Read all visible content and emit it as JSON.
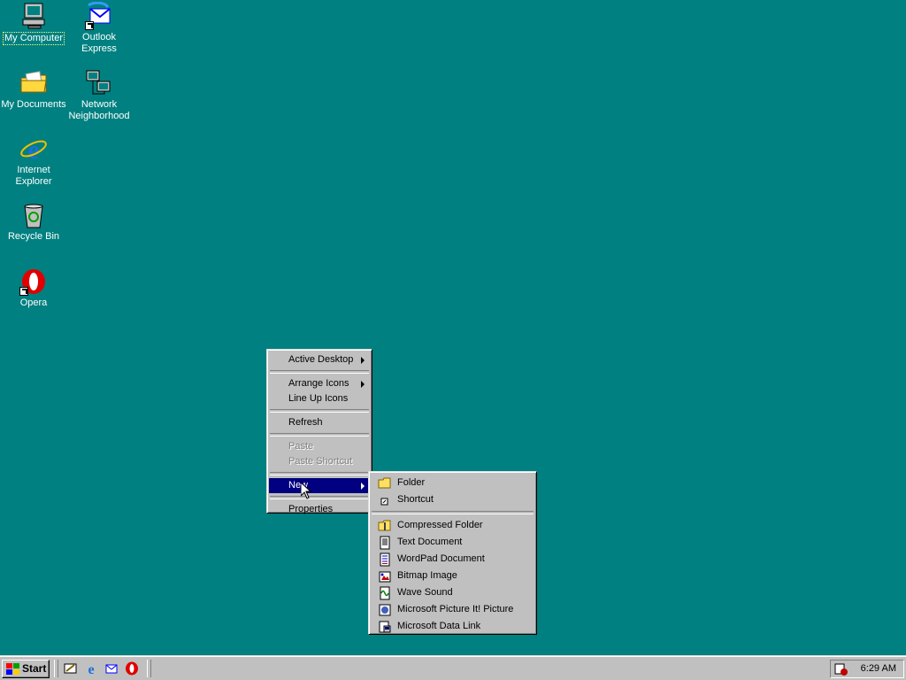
{
  "desktop": {
    "icons": [
      {
        "label": "My Computer",
        "selected": true
      },
      {
        "label": "Outlook Express"
      },
      {
        "label": "My Documents"
      },
      {
        "label": "Network Neighborhood"
      },
      {
        "label": "Internet Explorer"
      },
      {
        "label": "Recycle Bin"
      },
      {
        "label": "Opera"
      }
    ],
    "background_color": "#008080"
  },
  "context_menu": {
    "items": [
      {
        "label": "Active Desktop",
        "submenu": true
      },
      {
        "label": "Arrange Icons",
        "submenu": true
      },
      {
        "label": "Line Up Icons"
      },
      {
        "label": "Refresh"
      },
      {
        "label": "Paste",
        "disabled": true
      },
      {
        "label": "Paste Shortcut",
        "disabled": true
      },
      {
        "label": "New",
        "submenu": true,
        "highlighted": true
      },
      {
        "label": "Properties"
      }
    ]
  },
  "new_submenu": {
    "items": [
      {
        "label": "Folder",
        "icon": "folder-icon"
      },
      {
        "label": "Shortcut",
        "icon": "shortcut-icon"
      },
      {
        "label": "Compressed Folder",
        "icon": "compressed-folder-icon"
      },
      {
        "label": "Text Document",
        "icon": "text-document-icon"
      },
      {
        "label": "WordPad Document",
        "icon": "wordpad-document-icon"
      },
      {
        "label": "Bitmap Image",
        "icon": "bitmap-image-icon"
      },
      {
        "label": "Wave Sound",
        "icon": "wave-sound-icon"
      },
      {
        "label": "Microsoft Picture It! Picture",
        "icon": "picture-it-icon"
      },
      {
        "label": "Microsoft Data Link",
        "icon": "data-link-icon"
      }
    ]
  },
  "taskbar": {
    "start_label": "Start",
    "quick_launch": [
      "show-desktop-icon",
      "internet-explorer-icon",
      "outlook-express-icon",
      "opera-icon"
    ],
    "clock": "6:29 AM"
  },
  "colors": {
    "highlight": "#000080",
    "face": "#c0c0c0"
  }
}
